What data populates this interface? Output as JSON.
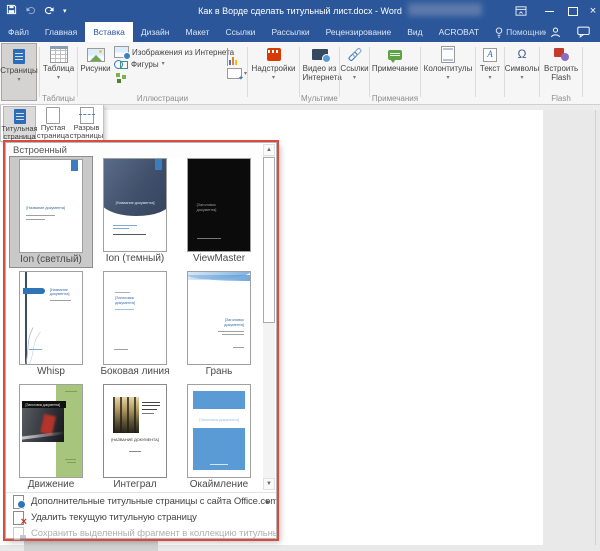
{
  "window": {
    "title": "Как в Ворде сделать титульный лист.docx - Word"
  },
  "icons": {
    "dropdown_caret": "▾",
    "submenu_arrow": "▸",
    "scroll_up": "▲",
    "scroll_down": "▼",
    "close": "×",
    "omega": "Ω",
    "text_icon": "A",
    "names": [
      "save-icon",
      "undo-icon",
      "redo-icon",
      "customize-qat-icon",
      "ribbon-display-options-icon",
      "minimize-icon",
      "maximize-icon",
      "close-icon",
      "lightbulb-icon",
      "account-icon",
      "comments-icon",
      "collapse-ribbon-icon"
    ]
  },
  "tabs": [
    {
      "label": "Файл"
    },
    {
      "label": "Главная"
    },
    {
      "label": "Вставка",
      "active": true
    },
    {
      "label": "Дизайн"
    },
    {
      "label": "Макет"
    },
    {
      "label": "Ссылки"
    },
    {
      "label": "Рассылки"
    },
    {
      "label": "Рецензирование"
    },
    {
      "label": "Вид"
    },
    {
      "label": "ACROBAT"
    },
    {
      "label": "Помощник"
    }
  ],
  "ribbon": {
    "pages_button": "Страницы",
    "tables_group": {
      "button": "Таблица",
      "label": "Таблицы"
    },
    "illustrations_group": {
      "pictures": "Рисунки",
      "online_pictures": "Изображения из Интернета",
      "shapes": "Фигуры",
      "label": "Иллюстрации"
    },
    "addins_button": "Надстройки",
    "media_group": {
      "video": "Видео из Интернета",
      "label": "Мультиме..."
    },
    "links_button": "Ссылки",
    "comments_group": {
      "button": "Примечание",
      "label": "Примечания"
    },
    "header_footer_button": "Колонтитулы",
    "text_button": "Текст",
    "symbols_button": "Символы",
    "flash_group": {
      "button": "Встроить Flash",
      "label": "Flash"
    }
  },
  "pages_menu": {
    "items": [
      {
        "label": "Титульная страница",
        "active": true
      },
      {
        "label": "Пустая страница"
      },
      {
        "label": "Разрыв страницы"
      }
    ]
  },
  "gallery": {
    "header": "Встроенный",
    "items": [
      {
        "name": "Ion (светлый)",
        "selected": true,
        "placeholder": "[Название документа]"
      },
      {
        "name": "Ion (темный)",
        "placeholder": "[Название документа]"
      },
      {
        "name": "ViewMaster",
        "placeholder": "[Заголовок документа]"
      },
      {
        "name": "Whisp",
        "placeholder": "[Название документа]"
      },
      {
        "name": "Боковая линия",
        "placeholder": "[Заголовок документа]"
      },
      {
        "name": "Грань",
        "placeholder": "[Заголовок документа]"
      },
      {
        "name": "Движение",
        "placeholder": "[Заголовок документа]"
      },
      {
        "name": "Интеграл",
        "placeholder": "[НАЗВАНИЕ ДОКУМЕНТА]"
      },
      {
        "name": "Окаймление",
        "placeholder": "[Заголовок документа]"
      }
    ],
    "menu": [
      {
        "label": "Дополнительные титульные страницы с сайта Office.com",
        "enabled": true,
        "submenu": true
      },
      {
        "label": "Удалить текущую титульную страницу",
        "enabled": true
      },
      {
        "label": "Сохранить выделенный фрагмент в коллекцию титульных страниц...",
        "enabled": false
      }
    ]
  },
  "colors": {
    "titlebar": "#2b579a",
    "annotation_border": "#d84b3f",
    "selection_bg": "#c9c9c9",
    "accent_blue": "#5b9bd5"
  }
}
